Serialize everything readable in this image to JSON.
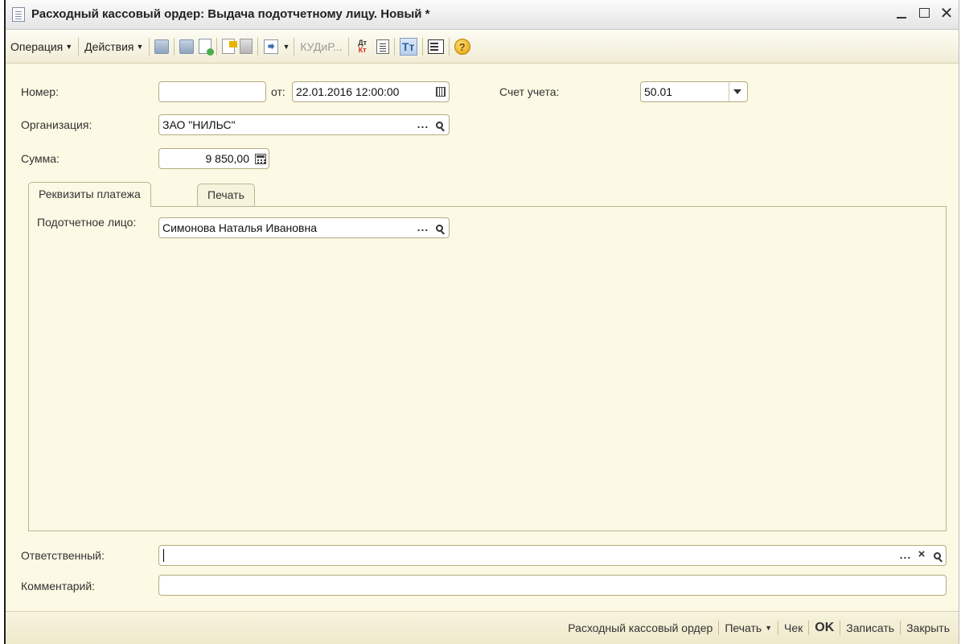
{
  "window": {
    "title": "Расходный кассовый ордер: Выдача подотчетному лицу. Новый *"
  },
  "toolbar": {
    "operation_label": "Операция",
    "actions_label": "Действия",
    "kud_label": "КУДиР...",
    "dtkt_top": "Дт",
    "dtkt_bottom": "Кт",
    "tt_label": "Тт",
    "help_label": "?"
  },
  "header": {
    "number_label": "Номер:",
    "number_value": "",
    "date_label": "от:",
    "date_value": "22.01.2016 12:00:00",
    "account_label": "Счет учета:",
    "account_value": "50.01",
    "organization_label": "Организация:",
    "organization_value": "ЗАО \"НИЛЬС\"",
    "sum_label": "Сумма:",
    "sum_value": "9 850,00"
  },
  "tabs": [
    {
      "label": "Реквизиты платежа",
      "active": true
    },
    {
      "label": "Печать",
      "active": false
    }
  ],
  "payment": {
    "person_label": "Подотчетное лицо:",
    "person_value": "Симонова Наталья Ивановна"
  },
  "bottom": {
    "responsible_label": "Ответственный:",
    "responsible_value": "",
    "comment_label": "Комментарий:",
    "comment_value": ""
  },
  "footer": {
    "order_label": "Расходный кассовый ордер",
    "print_label": "Печать",
    "check_label": "Чек",
    "ok_label": "OK",
    "save_label": "Записать",
    "close_label": "Закрыть"
  },
  "icons": {
    "lookup_button": "...",
    "search": "magnifier-icon",
    "clear": "×"
  }
}
